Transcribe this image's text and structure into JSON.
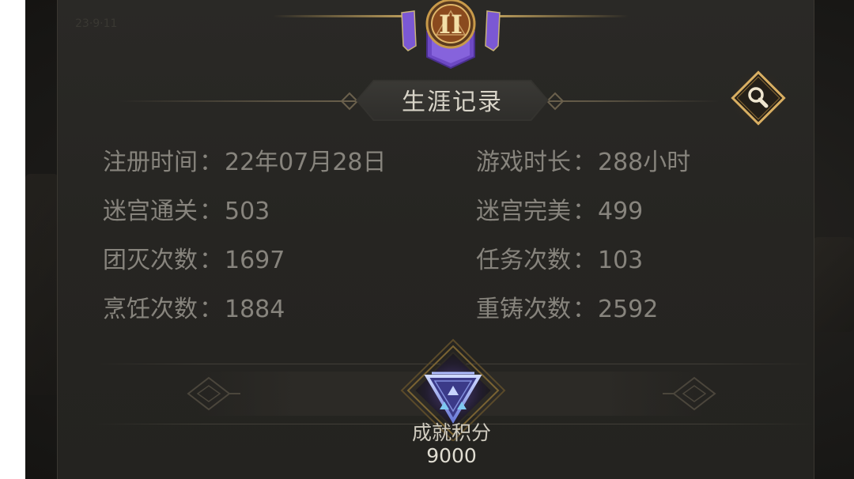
{
  "header": {
    "rank_numeral": "II",
    "faint_player_text": "23·9·11"
  },
  "panel": {
    "title": "生涯记录",
    "search_icon": "magnifier-icon"
  },
  "stats": {
    "left": [
      {
        "label": "注册时间",
        "value": "22年07月28日"
      },
      {
        "label": "迷宫通关",
        "value": "503"
      },
      {
        "label": "团灭次数",
        "value": "1697"
      },
      {
        "label": "烹饪次数",
        "value": "1884"
      }
    ],
    "right": [
      {
        "label": "游戏时长",
        "value": "288小时"
      },
      {
        "label": "迷宫完美",
        "value": "499"
      },
      {
        "label": "任务次数",
        "value": "103"
      },
      {
        "label": "重铸次数",
        "value": "2592"
      }
    ],
    "separator": "："
  },
  "achievement": {
    "label": "成就积分",
    "value": "9000",
    "icon": "triangle-crest-icon"
  },
  "colors": {
    "accent_gold": "#b89a5a",
    "rank_purple": "#7d57d6",
    "stat_text": "#87847d",
    "title_text": "#d8d4c8"
  }
}
